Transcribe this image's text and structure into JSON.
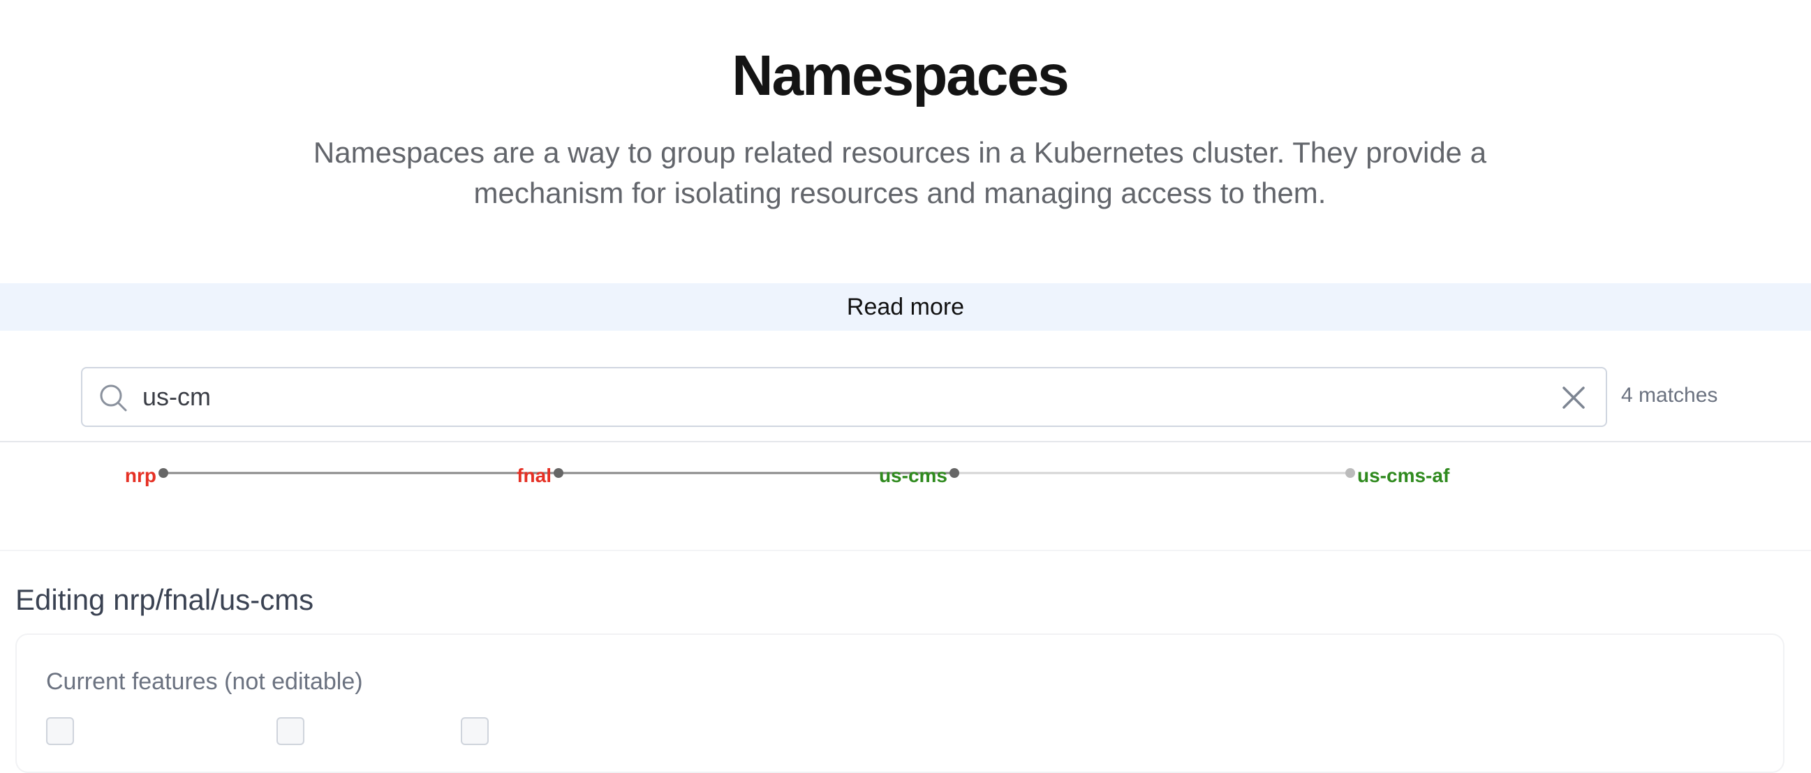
{
  "header": {
    "title": "Namespaces",
    "description": "Namespaces are a way to group related resources in a Kubernetes cluster. They provide a mechanism for isolating resources and managing access to them."
  },
  "read_more": {
    "label": "Read more"
  },
  "search": {
    "value": "us-cm",
    "match_count": "4 matches"
  },
  "path": {
    "nodes": [
      {
        "label": "nrp",
        "color": "#e53024"
      },
      {
        "label": "fnal",
        "color": "#e53024"
      },
      {
        "label": "us-cms",
        "color": "#2f8a1e"
      },
      {
        "label": "us-cms-af",
        "color": "#2f8a1e"
      }
    ],
    "line_color_active": "#888888",
    "line_color_inactive": "#d4d4d4"
  },
  "editor": {
    "title": "Editing nrp/fnal/us-cms",
    "current_features_label": "Current features (not editable)",
    "features": [
      "",
      "",
      ""
    ]
  }
}
